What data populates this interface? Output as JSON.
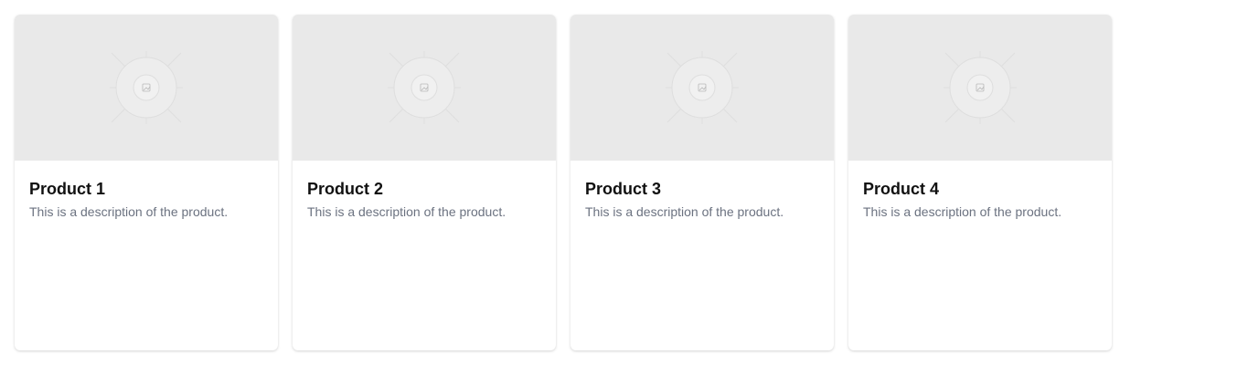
{
  "products": [
    {
      "title": "Product 1",
      "description": "This is a description of the product."
    },
    {
      "title": "Product 2",
      "description": "This is a description of the product."
    },
    {
      "title": "Product 3",
      "description": "This is a description of the product."
    },
    {
      "title": "Product 4",
      "description": "This is a description of the product."
    }
  ],
  "placeholder_icon": "image-placeholder-icon",
  "colors": {
    "thumbnail_bg": "#e9e9e9",
    "title": "#111111",
    "description": "#6b7280"
  }
}
